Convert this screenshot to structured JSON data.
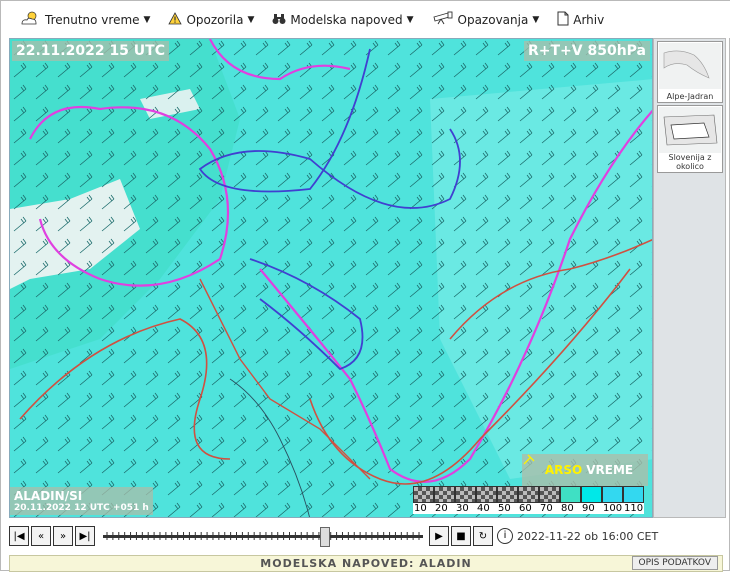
{
  "menu": [
    {
      "id": "weather",
      "label": "Trenutno vreme",
      "icon": "weather-icon",
      "has_dropdown": true
    },
    {
      "id": "warnings",
      "label": "Opozorila",
      "icon": "warning-icon",
      "has_dropdown": true
    },
    {
      "id": "model",
      "label": "Modelska napoved",
      "icon": "binoculars-icon",
      "has_dropdown": true
    },
    {
      "id": "obs",
      "label": "Opazovanja",
      "icon": "telescope-icon",
      "has_dropdown": true
    },
    {
      "id": "archive",
      "label": "Arhiv",
      "icon": "document-icon",
      "has_dropdown": false
    }
  ],
  "map": {
    "date_label": "22.11.2022 15 UTC",
    "field_label": "R+T+V 850hPa",
    "model_label": "ALADIN/SI",
    "model_run": "20.11.2022 12 UTC +051 h",
    "badge_arso": "ARSO",
    "badge_vreme": "VREME"
  },
  "legend": {
    "ticks": [
      "10",
      "20",
      "30",
      "40",
      "50",
      "60",
      "70",
      "80",
      "90",
      "100",
      "110"
    ],
    "colors": [
      "#c8c8c8",
      "#c8c8c8",
      "#c8c8c8",
      "#c8c8c8",
      "#c8c8c8",
      "#c8c8c8",
      "#c8c8c8",
      "#3fe0c4",
      "#00e8e8",
      "#33d8f0",
      "#33d8f0"
    ]
  },
  "side": {
    "thumb1": "Alpe-Jadran",
    "thumb2": "Slovenija z okolico"
  },
  "controls": {
    "time_text": "2022-11-22 ob 16:00 CET",
    "slider_value": 0.7
  },
  "footer": {
    "title": "MODELSKA NAPOVED: ALADIN",
    "button": "OPIS PODATKOV"
  }
}
